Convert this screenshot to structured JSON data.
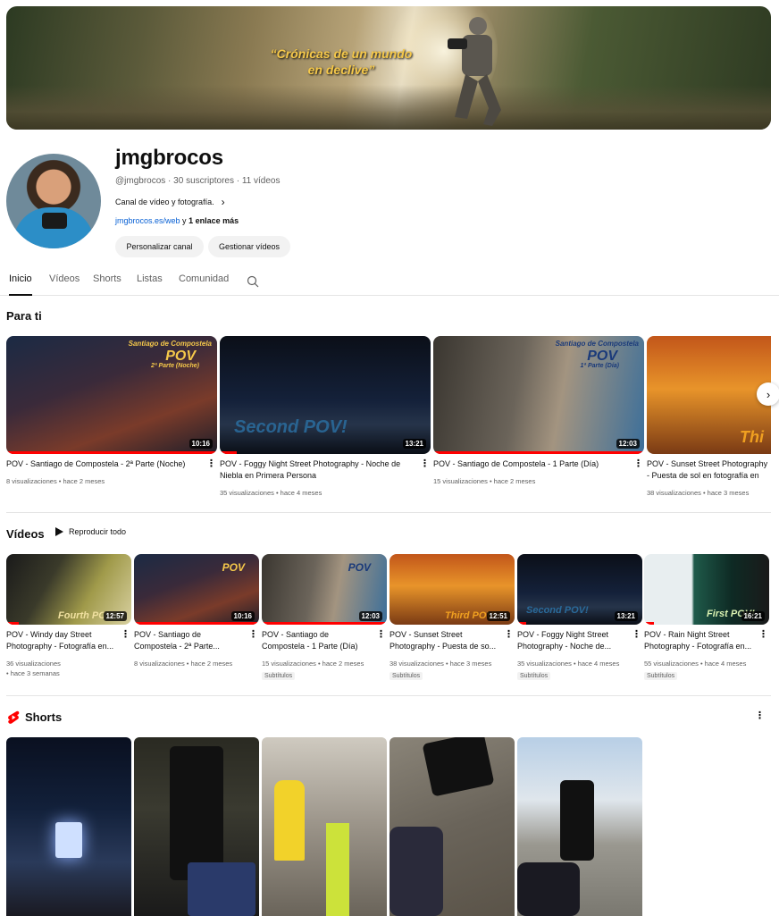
{
  "banner": {
    "quote_line1": "“Crónicas de un mundo",
    "quote_line2": "en declive”"
  },
  "channel": {
    "name": "jmgbrocos",
    "meta": "@jmgbrocos · 30 suscriptores · 11 vídeos",
    "description": "Canal de vídeo y fotografía.",
    "link": "jmgbrocos.es/web",
    "link_more_prefix": " y ",
    "link_more": "1 enlace más",
    "customize_label": "Personalizar canal",
    "manage_label": "Gestionar vídeos"
  },
  "tabs": [
    "Inicio",
    "Vídeos",
    "Shorts",
    "Listas",
    "Comunidad"
  ],
  "for_you": {
    "title": "Para ti",
    "items": [
      {
        "title": "POV - Santiago de Compostela - 2ª Parte (Noche)",
        "meta": "8 visualizaciones • hace 2 meses",
        "duration": "10:16",
        "overlay1": "Santiago de Compostela",
        "overlay2": "POV",
        "overlay3": "2ª Parte (Noche)",
        "progress": 1.0
      },
      {
        "title": "POV - Foggy Night Street Photography - Noche de Niebla en Primera Persona",
        "meta": "35 visualizaciones • hace 4 meses",
        "duration": "13:21",
        "overlay1": "Second POV!",
        "progress": 0.08
      },
      {
        "title": "POV - Santiago de Compostela - 1 Parte (Día)",
        "meta": "15 visualizaciones • hace 2 meses",
        "duration": "12:03",
        "overlay1": "Santiago de Compostela",
        "overlay2": "POV",
        "overlay3": "1ª Parte (Día)",
        "progress": 1.0
      },
      {
        "title": "POV - Sunset Street Photography - Puesta de sol en fotografía en Primera Persona",
        "meta": "38 visualizaciones • hace 3 meses",
        "duration": "",
        "overlay1": "Thi",
        "progress": 0.0
      }
    ]
  },
  "videos": {
    "title": "Vídeos",
    "play_all": "Reproducir todo",
    "items": [
      {
        "title1": "POV - Windy day Street",
        "title2": "Photography - Fotografía en...",
        "meta1": "36 visualizaciones",
        "meta2": "• hace 3 semanas",
        "duration": "12:57",
        "overlay": "Fourth POV!",
        "badge": "",
        "progress": 0.1
      },
      {
        "title1": "POV - Santiago de",
        "title2": "Compostela - 2ª Parte...",
        "meta1": "8 visualizaciones • hace 2 meses",
        "meta2": "",
        "duration": "10:16",
        "overlay": "POV",
        "badge": "",
        "progress": 1.0
      },
      {
        "title1": "POV - Santiago de",
        "title2": "Compostela - 1 Parte (Día)",
        "meta1": "15 visualizaciones • hace 2 meses",
        "meta2": "",
        "duration": "12:03",
        "overlay": "POV",
        "badge": "Subtítulos",
        "progress": 1.0
      },
      {
        "title1": "POV - Sunset Street",
        "title2": "Photography - Puesta de so...",
        "meta1": "38 visualizaciones • hace 3 meses",
        "meta2": "",
        "duration": "12:51",
        "overlay": "Third POV!",
        "badge": "Subtítulos",
        "progress": 0.0
      },
      {
        "title1": "POV - Foggy Night Street",
        "title2": "Photography - Noche de...",
        "meta1": "35 visualizaciones • hace 4 meses",
        "meta2": "",
        "duration": "13:21",
        "overlay": "Second POV!",
        "badge": "Subtítulos",
        "progress": 0.07
      },
      {
        "title1": "POV - Rain Night Street",
        "title2": "Photography - Fotografía en...",
        "meta1": "55 visualizaciones • hace 4 meses",
        "meta2": "",
        "duration": "16:21",
        "overlay": "First POV!",
        "badge": "Subtítulos",
        "progress": 0.08
      }
    ]
  },
  "shorts": {
    "title": "Shorts"
  },
  "colors": {
    "accent": "#ff0000",
    "link": "#065fd4",
    "text": "#0f0f0f",
    "secondary": "#606060",
    "pill": "#f2f2f2"
  },
  "icons": {
    "search": "search-icon",
    "play": "play-icon",
    "more": "more-vert-icon",
    "next": "chevron-right-icon",
    "shorts": "shorts-logo-icon"
  }
}
